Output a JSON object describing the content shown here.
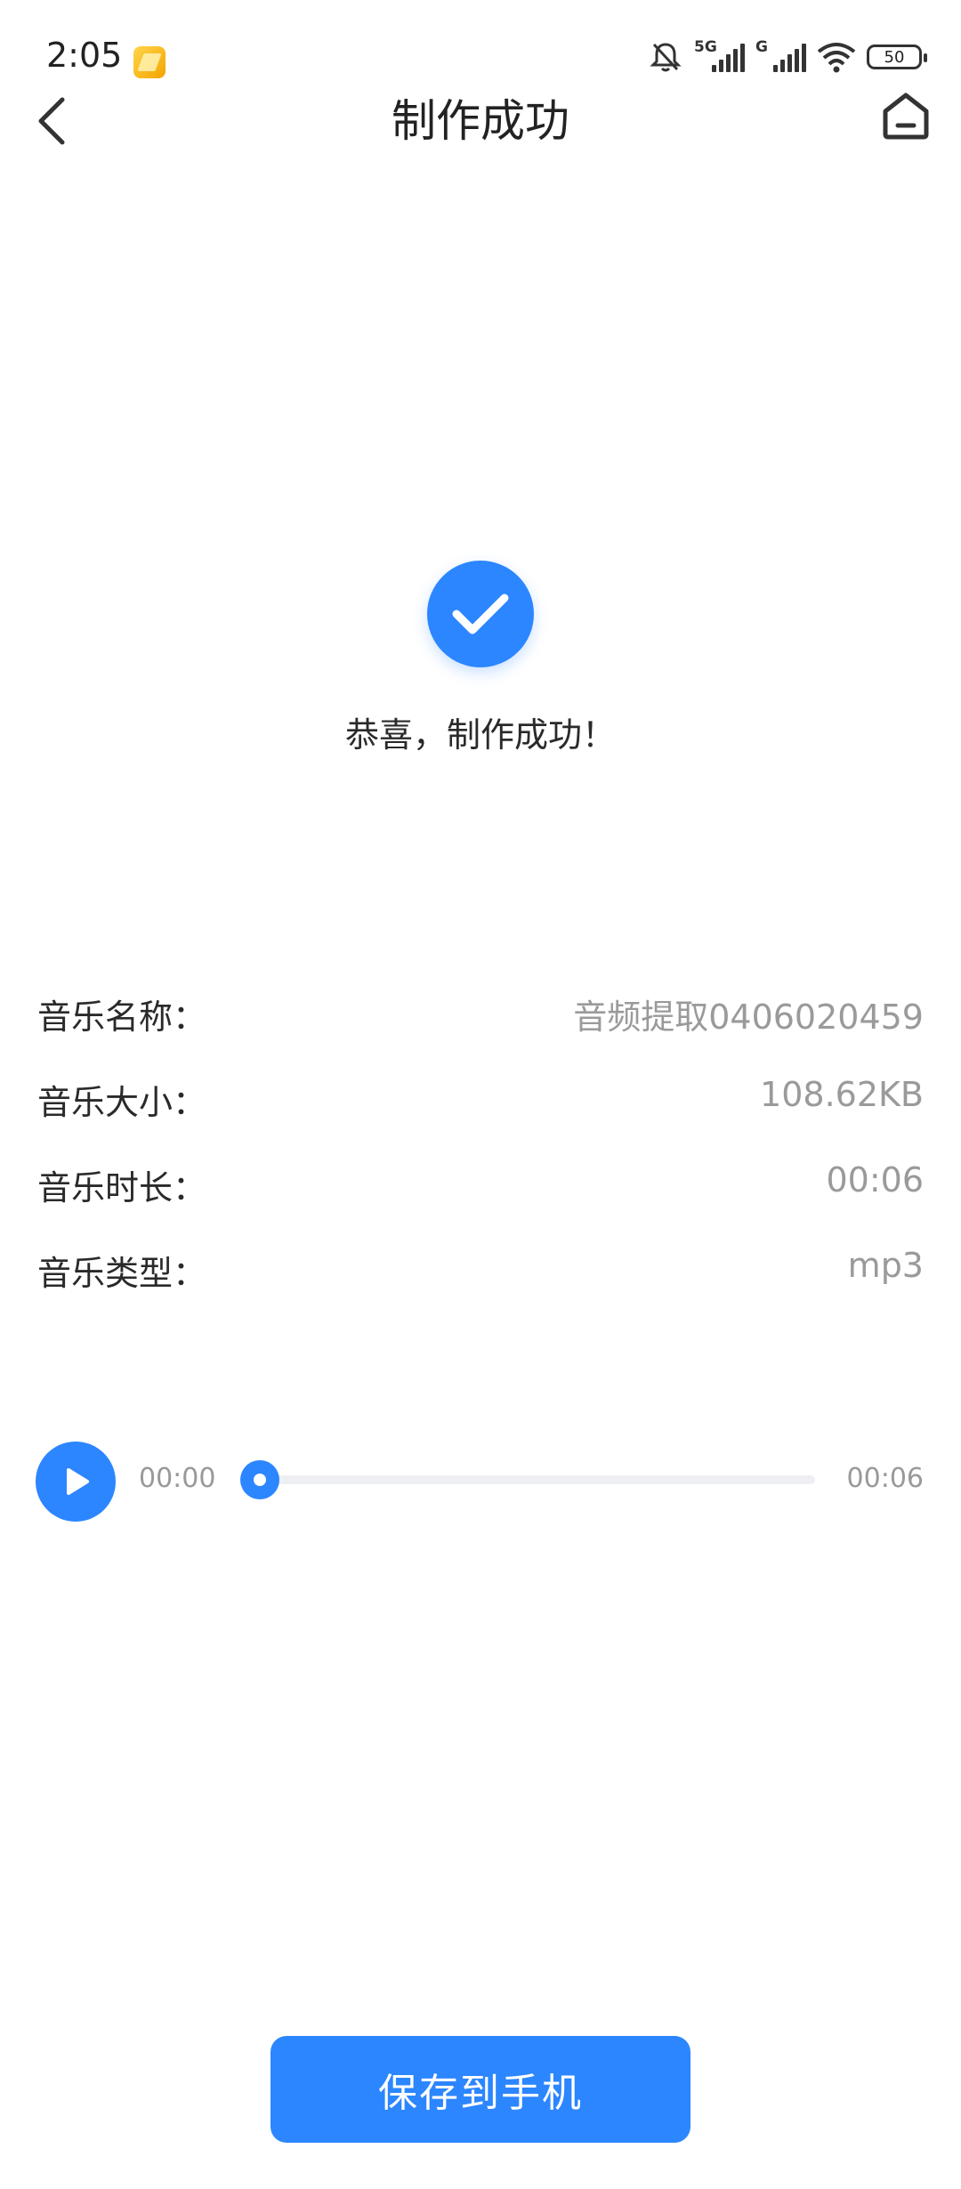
{
  "status_bar": {
    "time": "2:05",
    "signal_1_tag": "5G",
    "signal_2_tag": "G",
    "battery_level": "50",
    "icons": [
      "notification-app-icon",
      "mute-bell-icon",
      "signal-5g-icon",
      "signal-g-icon",
      "wifi-icon",
      "battery-icon"
    ]
  },
  "header": {
    "title": "制作成功",
    "back_icon": "chevron-left-icon",
    "home_icon": "home-icon"
  },
  "success": {
    "icon": "check-circle-icon",
    "message": "恭喜，制作成功！"
  },
  "info": [
    {
      "label": "音乐名称：",
      "value": "音频提取0406020459"
    },
    {
      "label": "音乐大小：",
      "value": "108.62KB"
    },
    {
      "label": "音乐时长：",
      "value": "00:06"
    },
    {
      "label": "音乐类型：",
      "value": "mp3"
    }
  ],
  "player": {
    "current_time": "00:00",
    "total_time": "00:06",
    "progress": 0,
    "play_icon": "play-icon"
  },
  "actions": {
    "save_label": "保存到手机"
  },
  "colors": {
    "accent": "#2c86ff",
    "text_primary": "#2a2a2a",
    "text_secondary": "#9a9a9a",
    "track": "#eeeff3"
  }
}
